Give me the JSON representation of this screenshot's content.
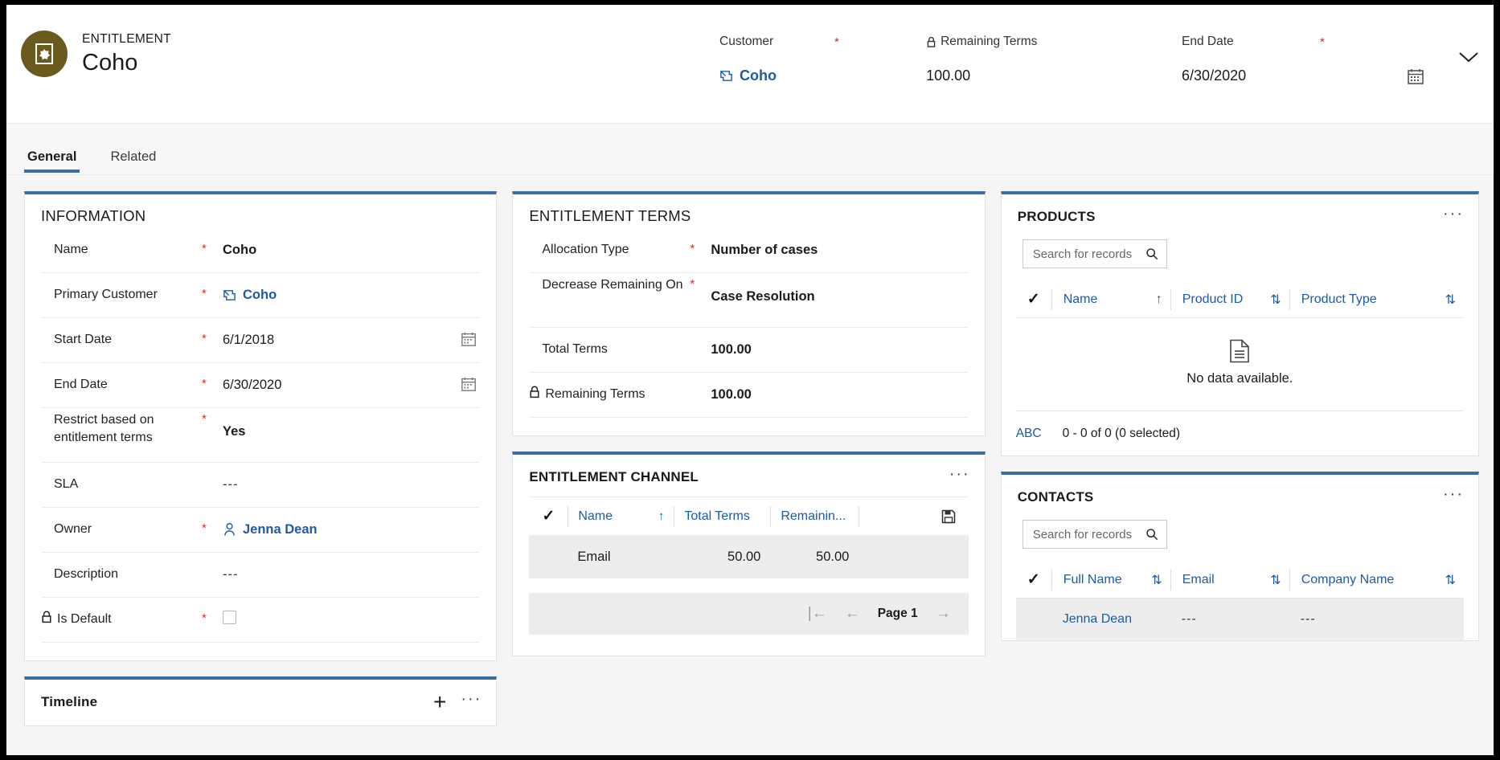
{
  "header": {
    "avatar_color": "#6b5a1e",
    "avatar_icon": "entitlement-icon",
    "eyebrow": "ENTITLEMENT",
    "title": "Coho",
    "fields": [
      {
        "label": "Customer",
        "required": "*",
        "value": "Coho",
        "icon": "account-entity-icon"
      },
      {
        "label": "Remaining Terms",
        "required": "",
        "value": "100.00",
        "icon": "lock-icon"
      },
      {
        "label": "End Date",
        "required": "*",
        "value": "6/30/2020",
        "icon": ""
      }
    ],
    "calendar_icon": "calendar-icon",
    "chevron_icon": "chevron-down-icon"
  },
  "tabs": [
    {
      "label": "General",
      "active": true
    },
    {
      "label": "Related",
      "active": false
    }
  ],
  "information": {
    "title": "INFORMATION",
    "rows": [
      {
        "label": "Name",
        "required": "*",
        "value": "Coho",
        "bold": true
      },
      {
        "label": "Primary Customer",
        "required": "*",
        "value": "Coho",
        "link": true,
        "icon": "account-entity-icon"
      },
      {
        "label": "Start Date",
        "required": "*",
        "value": "6/1/2018",
        "calendar": true
      },
      {
        "label": "End Date",
        "required": "*",
        "value": "6/30/2020",
        "calendar": true
      },
      {
        "label": "Restrict based on entitlement terms",
        "required": "*",
        "value": "Yes",
        "bold": true,
        "twoline": true
      },
      {
        "label": "SLA",
        "required": "",
        "value": "---"
      },
      {
        "label": "Owner",
        "required": "*",
        "value": "Jenna Dean",
        "link": true,
        "icon": "person-icon"
      },
      {
        "label": "Description",
        "required": "",
        "value": "---"
      },
      {
        "label": "Is Default",
        "required": "*",
        "value": "",
        "checkbox": true,
        "checked": false,
        "lock": true
      }
    ]
  },
  "timeline": {
    "title": "Timeline",
    "add_label": "+",
    "more_label": "···"
  },
  "entitlement_terms": {
    "title": "ENTITLEMENT TERMS",
    "rows": [
      {
        "label": "Allocation Type",
        "required": "*",
        "value": "Number of cases",
        "bold": true
      },
      {
        "label": "Decrease Remaining On",
        "required": "*",
        "value": "Case Resolution",
        "bold": true,
        "twoline": true
      },
      {
        "label": "Total Terms",
        "required": "",
        "value": "100.00",
        "bold": true
      },
      {
        "label": "Remaining Terms",
        "required": "",
        "value": "100.00",
        "bold": true,
        "lock": true
      }
    ]
  },
  "entitlement_channel": {
    "title": "ENTITLEMENT CHANNEL",
    "more_label": "···",
    "save_icon": "save-icon",
    "columns": [
      {
        "label": "Name",
        "sort": "↑"
      },
      {
        "label": "Total Terms",
        "sort": ""
      },
      {
        "label": "Remainin...",
        "sort": ""
      }
    ],
    "rows": [
      {
        "name": "Email",
        "total_terms": "50.00",
        "remaining": "50.00"
      }
    ],
    "pager": {
      "first": "|←",
      "prev": "←",
      "page_label": "Page 1",
      "next": "→"
    }
  },
  "products": {
    "title": "PRODUCTS",
    "more_label": "···",
    "search_placeholder": "Search for records",
    "search_value": "",
    "columns": [
      {
        "label": "Name",
        "sort": "↑"
      },
      {
        "label": "Product ID",
        "sort": "⇅"
      },
      {
        "label": "Product Type",
        "sort": "⇅"
      }
    ],
    "empty_text": "No data available.",
    "empty_icon": "document-icon",
    "footer_link": "ABC",
    "footer_count": "0 - 0 of 0 (0 selected)"
  },
  "contacts": {
    "title": "CONTACTS",
    "more_label": "···",
    "search_placeholder": "Search for records",
    "search_value": "",
    "columns": [
      {
        "label": "Full Name",
        "sort": "⇅"
      },
      {
        "label": "Email",
        "sort": "⇅"
      },
      {
        "label": "Company Name",
        "sort": "⇅"
      }
    ],
    "rows": [
      {
        "full_name": "Jenna Dean",
        "email": "---",
        "company": "---"
      }
    ]
  },
  "colors": {
    "accent_blue": "#3a6ea5",
    "link_blue": "#1c5ba8",
    "required_red": "#d62b2b",
    "avatar_olive": "#6b5a1e"
  }
}
